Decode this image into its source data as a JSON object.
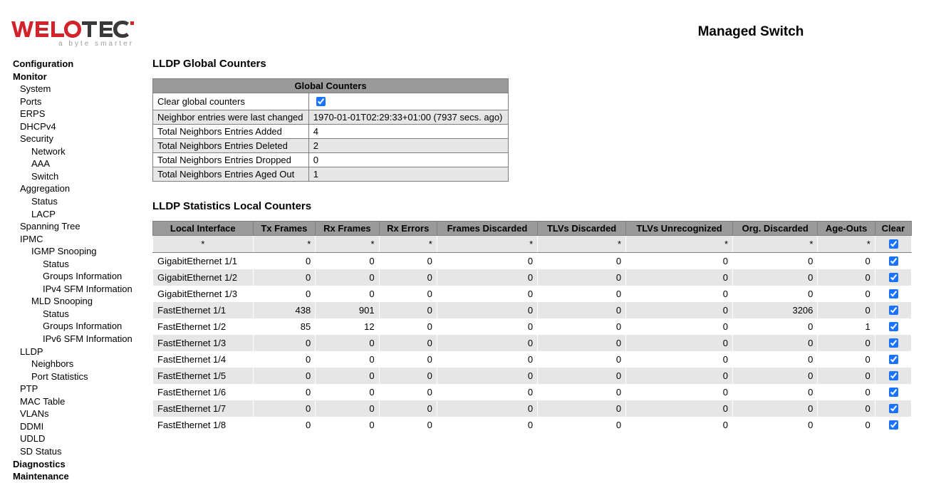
{
  "header": {
    "title": "Managed Switch"
  },
  "brand": {
    "tagline": "a byte smarter"
  },
  "sidebar": {
    "configuration": "Configuration",
    "monitor": "Monitor",
    "items1": {
      "system": "System",
      "ports": "Ports",
      "erps": "ERPS",
      "dhcpv4": "DHCPv4",
      "security": "Security"
    },
    "security": {
      "network": "Network",
      "aaa": "AAA",
      "switch": "Switch"
    },
    "aggregation": "Aggregation",
    "agg": {
      "status": "Status",
      "lacp": "LACP"
    },
    "spanning": "Spanning Tree",
    "ipmc": "IPMC",
    "igmp": "IGMP Snooping",
    "igmp_items": {
      "status": "Status",
      "groups": "Groups Information",
      "sfm": "IPv4 SFM Information"
    },
    "mld": "MLD Snooping",
    "mld_items": {
      "status": "Status",
      "groups": "Groups Information",
      "sfm": "IPv6 SFM Information"
    },
    "lldp": "LLDP",
    "lldp_items": {
      "neighbors": "Neighbors",
      "portstats": "Port Statistics"
    },
    "ptp": "PTP",
    "mac": "MAC Table",
    "vlans": "VLANs",
    "ddmi": "DDMI",
    "udld": "UDLD",
    "sd": "SD Status",
    "diagnostics": "Diagnostics",
    "maintenance": "Maintenance"
  },
  "global": {
    "heading": "LLDP Global Counters",
    "title": "Global Counters",
    "r1": {
      "label": "Clear global counters"
    },
    "r2": {
      "label": "Neighbor entries were last changed",
      "value": "1970-01-01T02:29:33+01:00 (7937 secs. ago)"
    },
    "r3": {
      "label": "Total Neighbors Entries Added",
      "value": "4"
    },
    "r4": {
      "label": "Total Neighbors Entries Deleted",
      "value": "2"
    },
    "r5": {
      "label": "Total Neighbors Entries Dropped",
      "value": "0"
    },
    "r6": {
      "label": "Total Neighbors Entries Aged Out",
      "value": "1"
    }
  },
  "stats": {
    "heading": "LLDP Statistics Local Counters",
    "cols": {
      "iface": "Local Interface",
      "tx": "Tx Frames",
      "rx": "Rx Frames",
      "rxerr": "Rx Errors",
      "fdisc": "Frames Discarded",
      "tdisc": "TLVs Discarded",
      "tunrec": "TLVs Unrecognized",
      "odisc": "Org. Discarded",
      "age": "Age-Outs",
      "clear": "Clear"
    },
    "sum": {
      "iface": "*",
      "tx": "*",
      "rx": "*",
      "rxerr": "*",
      "fdisc": "*",
      "tdisc": "*",
      "tunrec": "*",
      "odisc": "*",
      "age": "*"
    },
    "rows": [
      {
        "iface": "GigabitEthernet 1/1",
        "tx": "0",
        "rx": "0",
        "rxerr": "0",
        "fdisc": "0",
        "tdisc": "0",
        "tunrec": "0",
        "odisc": "0",
        "age": "0"
      },
      {
        "iface": "GigabitEthernet 1/2",
        "tx": "0",
        "rx": "0",
        "rxerr": "0",
        "fdisc": "0",
        "tdisc": "0",
        "tunrec": "0",
        "odisc": "0",
        "age": "0"
      },
      {
        "iface": "GigabitEthernet 1/3",
        "tx": "0",
        "rx": "0",
        "rxerr": "0",
        "fdisc": "0",
        "tdisc": "0",
        "tunrec": "0",
        "odisc": "0",
        "age": "0"
      },
      {
        "iface": "FastEthernet 1/1",
        "tx": "438",
        "rx": "901",
        "rxerr": "0",
        "fdisc": "0",
        "tdisc": "0",
        "tunrec": "0",
        "odisc": "3206",
        "age": "0"
      },
      {
        "iface": "FastEthernet 1/2",
        "tx": "85",
        "rx": "12",
        "rxerr": "0",
        "fdisc": "0",
        "tdisc": "0",
        "tunrec": "0",
        "odisc": "0",
        "age": "1"
      },
      {
        "iface": "FastEthernet 1/3",
        "tx": "0",
        "rx": "0",
        "rxerr": "0",
        "fdisc": "0",
        "tdisc": "0",
        "tunrec": "0",
        "odisc": "0",
        "age": "0"
      },
      {
        "iface": "FastEthernet 1/4",
        "tx": "0",
        "rx": "0",
        "rxerr": "0",
        "fdisc": "0",
        "tdisc": "0",
        "tunrec": "0",
        "odisc": "0",
        "age": "0"
      },
      {
        "iface": "FastEthernet 1/5",
        "tx": "0",
        "rx": "0",
        "rxerr": "0",
        "fdisc": "0",
        "tdisc": "0",
        "tunrec": "0",
        "odisc": "0",
        "age": "0"
      },
      {
        "iface": "FastEthernet 1/6",
        "tx": "0",
        "rx": "0",
        "rxerr": "0",
        "fdisc": "0",
        "tdisc": "0",
        "tunrec": "0",
        "odisc": "0",
        "age": "0"
      },
      {
        "iface": "FastEthernet 1/7",
        "tx": "0",
        "rx": "0",
        "rxerr": "0",
        "fdisc": "0",
        "tdisc": "0",
        "tunrec": "0",
        "odisc": "0",
        "age": "0"
      },
      {
        "iface": "FastEthernet 1/8",
        "tx": "0",
        "rx": "0",
        "rxerr": "0",
        "fdisc": "0",
        "tdisc": "0",
        "tunrec": "0",
        "odisc": "0",
        "age": "0"
      }
    ]
  }
}
